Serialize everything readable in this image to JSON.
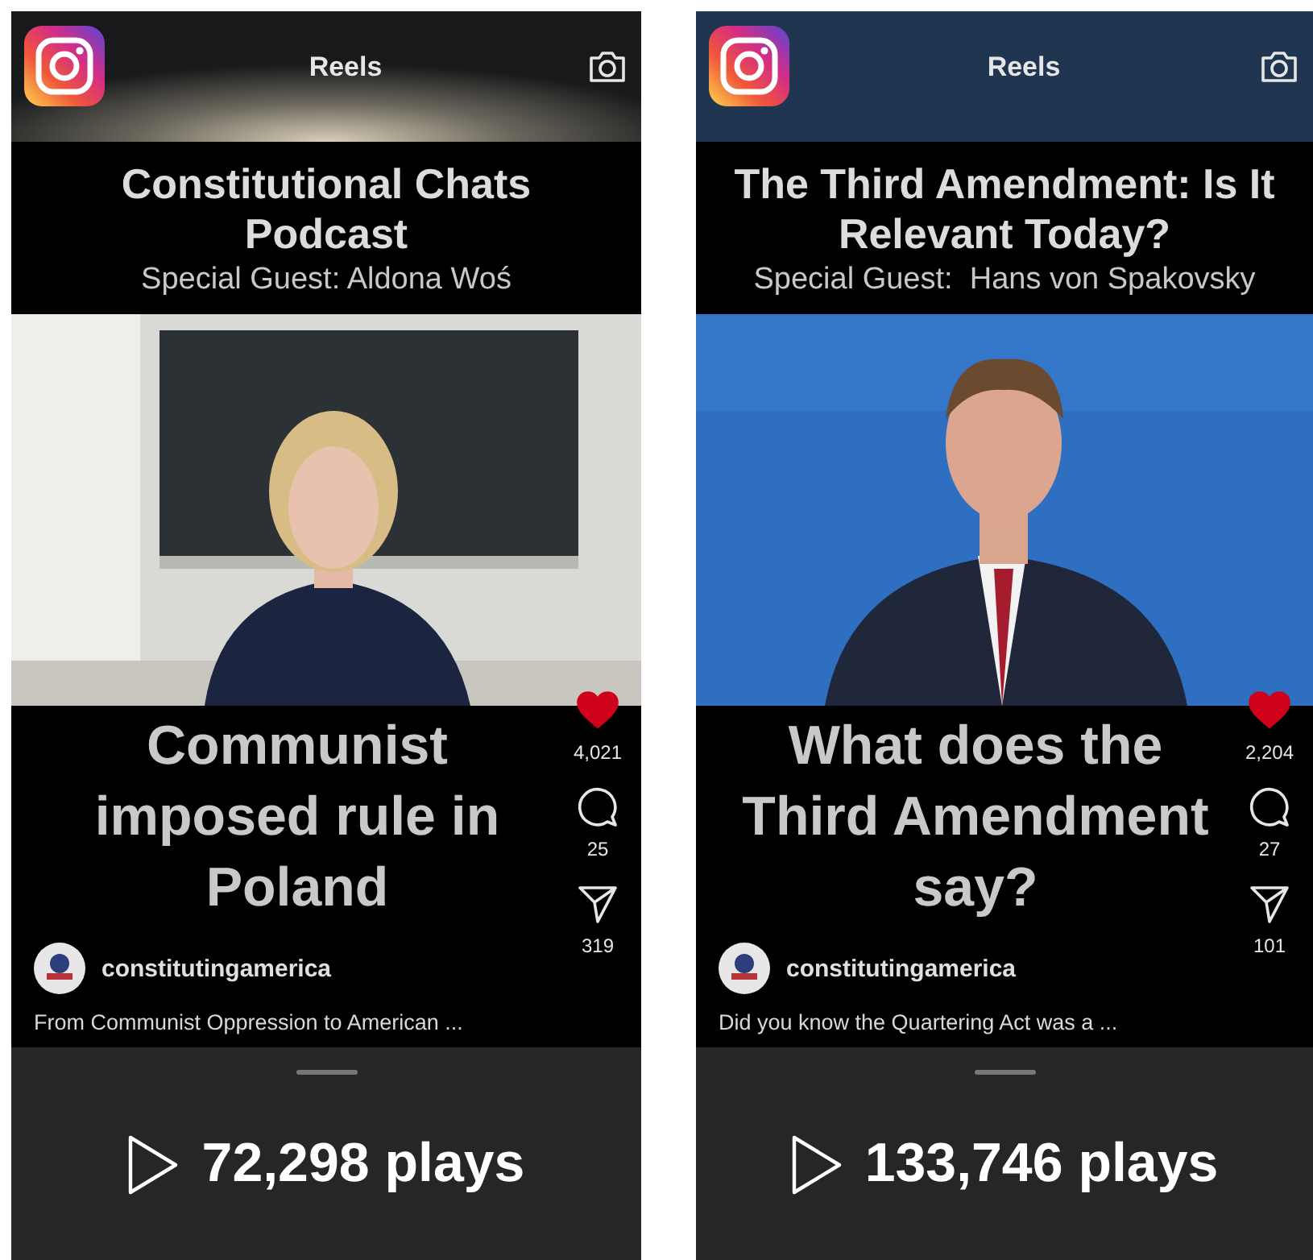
{
  "reels": [
    {
      "header": {
        "title": "Reels"
      },
      "title": "Constitutional Chats Podcast",
      "subtitle": "Special Guest: Aldona Woś",
      "headline": "Communist imposed rule in Poland",
      "liked": true,
      "likes": "4,021",
      "comments": "25",
      "shares": "319",
      "account": "constitutingamerica",
      "description": "From Communist Oppression to American ...",
      "plays": "72,298 plays"
    },
    {
      "header": {
        "title": "Reels"
      },
      "title": "The Third Amendment: Is It Relevant Today?",
      "subtitle": "Special Guest:  Hans von Spakovsky",
      "headline": "What does the Third Amendment say?",
      "liked": true,
      "likes": "2,204",
      "comments": "27",
      "shares": "101",
      "account": "constitutingamerica",
      "description": "Did you know the Quartering Act was a ...",
      "plays": "133,746 plays"
    }
  ]
}
